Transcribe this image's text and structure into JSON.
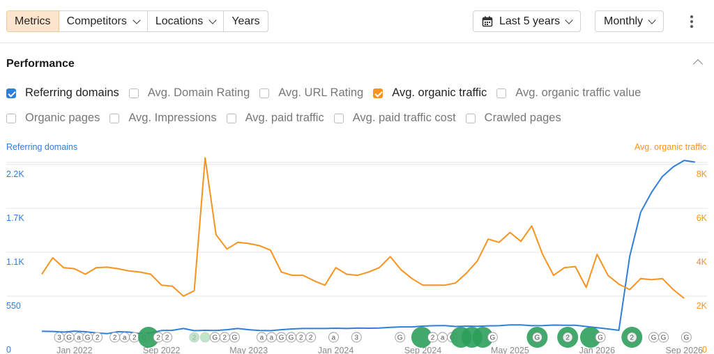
{
  "tabs": [
    {
      "label": "Metrics",
      "active": true,
      "dropdown": false
    },
    {
      "label": "Competitors",
      "active": false,
      "dropdown": true
    },
    {
      "label": "Locations",
      "active": false,
      "dropdown": true
    },
    {
      "label": "Years",
      "active": false,
      "dropdown": false
    }
  ],
  "period": {
    "label": "Last 5 years",
    "icon": "calendar-icon"
  },
  "granularity": {
    "label": "Monthly"
  },
  "menu_icon": "more-vertical-icon",
  "section": {
    "title": "Performance",
    "collapse_icon": "chevron-up-icon"
  },
  "metrics_row1": [
    {
      "label": "Referring domains",
      "checked": true,
      "color": "#2f7ed8"
    },
    {
      "label": "Avg. Domain Rating",
      "checked": false
    },
    {
      "label": "Avg. URL Rating",
      "checked": false
    },
    {
      "label": "Avg. organic traffic",
      "checked": true,
      "color": "#f7931e"
    },
    {
      "label": "Avg. organic traffic value",
      "checked": false
    }
  ],
  "metrics_row2": [
    {
      "label": "Organic pages",
      "checked": false
    },
    {
      "label": "Avg. Impressions",
      "checked": false
    },
    {
      "label": "Avg. paid traffic",
      "checked": false
    },
    {
      "label": "Avg. paid traffic cost",
      "checked": false
    },
    {
      "label": "Crawled pages",
      "checked": false
    }
  ],
  "colors": {
    "blue": "#2f7ed8",
    "orange": "#f7931e",
    "grid": "#e6e6e6",
    "marker_green": "#2e9e5b"
  },
  "chart_data": {
    "type": "line",
    "left_axis_title": "Referring domains",
    "right_axis_title": "Avg. organic traffic",
    "left_ticks": [
      "0",
      "550",
      "1.1K",
      "1.7K",
      "2.2K"
    ],
    "right_ticks": [
      "0",
      "2K",
      "4K",
      "6K",
      "8K"
    ],
    "x_labels": [
      "Jan 2022",
      "Sep 2022",
      "May 2023",
      "Jan 2024",
      "Sep 2024",
      "May 2025",
      "Jan 2026",
      "Sep 2026"
    ],
    "x_range": [
      0,
      57
    ],
    "x_tick_positions": [
      3,
      11,
      19,
      27,
      35,
      43,
      51,
      59
    ],
    "left_ylim": [
      0,
      2200
    ],
    "right_ylim": [
      0,
      8000
    ],
    "grid": true,
    "series": [
      {
        "name": "Referring domains",
        "axis": "left",
        "color": "#2f7ed8",
        "values": [
          110,
          108,
          100,
          112,
          105,
          90,
          80,
          105,
          100,
          80,
          90,
          120,
          122,
          145,
          118,
          122,
          120,
          130,
          145,
          130,
          120,
          118,
          130,
          140,
          145,
          145,
          145,
          148,
          145,
          150,
          148,
          150,
          160,
          165,
          165,
          175,
          180,
          182,
          170,
          175,
          172,
          178,
          180,
          190,
          190,
          180,
          182,
          188,
          185,
          185,
          170,
          155,
          140,
          122,
          1050,
          1600,
          1850,
          2050,
          2170,
          2250,
          2230
        ]
      },
      {
        "name": "Avg. organic traffic",
        "axis": "right",
        "color": "#f7931e",
        "values": [
          3000,
          3750,
          3300,
          3250,
          3000,
          3300,
          3320,
          3250,
          3150,
          3100,
          3000,
          2500,
          2450,
          2000,
          2250,
          8300,
          4800,
          4150,
          4450,
          4400,
          4300,
          4100,
          3100,
          2950,
          2950,
          2700,
          2500,
          3300,
          3000,
          2950,
          3100,
          3300,
          3800,
          3200,
          2800,
          2500,
          2500,
          2500,
          2600,
          3050,
          3600,
          4600,
          4450,
          4900,
          4500,
          5200,
          3900,
          2950,
          3300,
          3350,
          2400,
          3900,
          2950,
          2550,
          2300,
          2800,
          2750,
          2800,
          2300,
          1900
        ]
      }
    ],
    "annotations": [
      {
        "x": 1.6,
        "label": "3",
        "kind": "badge"
      },
      {
        "x": 2.5,
        "label": "G",
        "kind": "badge"
      },
      {
        "x": 3.4,
        "label": "a",
        "kind": "badge"
      },
      {
        "x": 4.2,
        "label": "G",
        "kind": "badge"
      },
      {
        "x": 5.1,
        "label": "2",
        "kind": "badge"
      },
      {
        "x": 6.7,
        "label": "2",
        "kind": "badge"
      },
      {
        "x": 7.6,
        "label": "a",
        "kind": "badge"
      },
      {
        "x": 8.5,
        "label": "2",
        "kind": "badge"
      },
      {
        "x": 9.4,
        "label": "G",
        "kind": "badge"
      },
      {
        "x": 9.8,
        "label": "",
        "kind": "big"
      },
      {
        "x": 10.7,
        "label": "2",
        "kind": "badge"
      },
      {
        "x": 11.5,
        "label": "2",
        "kind": "badge"
      },
      {
        "x": 14.0,
        "label": "2",
        "kind": "faint"
      },
      {
        "x": 15.0,
        "label": "",
        "kind": "faint"
      },
      {
        "x": 15.9,
        "label": "G",
        "kind": "badge"
      },
      {
        "x": 16.8,
        "label": "2",
        "kind": "badge"
      },
      {
        "x": 17.7,
        "label": "G",
        "kind": "badge"
      },
      {
        "x": 20.2,
        "label": "a",
        "kind": "badge"
      },
      {
        "x": 21.1,
        "label": "a",
        "kind": "badge"
      },
      {
        "x": 22.0,
        "label": "G",
        "kind": "badge"
      },
      {
        "x": 22.9,
        "label": "G",
        "kind": "badge"
      },
      {
        "x": 23.8,
        "label": "2",
        "kind": "badge"
      },
      {
        "x": 24.7,
        "label": "2",
        "kind": "badge"
      },
      {
        "x": 26.8,
        "label": "a",
        "kind": "badge"
      },
      {
        "x": 28.9,
        "label": "3",
        "kind": "badge"
      },
      {
        "x": 32.9,
        "label": "G",
        "kind": "badge"
      },
      {
        "x": 34.9,
        "label": "",
        "kind": "big"
      },
      {
        "x": 35.9,
        "label": "2",
        "kind": "badge"
      },
      {
        "x": 36.8,
        "label": "a",
        "kind": "badge"
      },
      {
        "x": 37.7,
        "label": "G",
        "kind": "badge"
      },
      {
        "x": 38.5,
        "label": "",
        "kind": "big"
      },
      {
        "x": 39.5,
        "label": "",
        "kind": "big"
      },
      {
        "x": 40.5,
        "label": "",
        "kind": "big"
      },
      {
        "x": 41.4,
        "label": "G",
        "kind": "badge"
      },
      {
        "x": 45.5,
        "label": "G",
        "kind": "big"
      },
      {
        "x": 48.3,
        "label": "2",
        "kind": "big"
      },
      {
        "x": 50.4,
        "label": "",
        "kind": "big"
      },
      {
        "x": 51.3,
        "label": "G",
        "kind": "badge"
      },
      {
        "x": 54.2,
        "label": "2",
        "kind": "big"
      },
      {
        "x": 56.2,
        "label": "G",
        "kind": "badge"
      },
      {
        "x": 57.1,
        "label": "G",
        "kind": "badge"
      },
      {
        "x": 59.2,
        "label": "G",
        "kind": "badge"
      }
    ]
  }
}
